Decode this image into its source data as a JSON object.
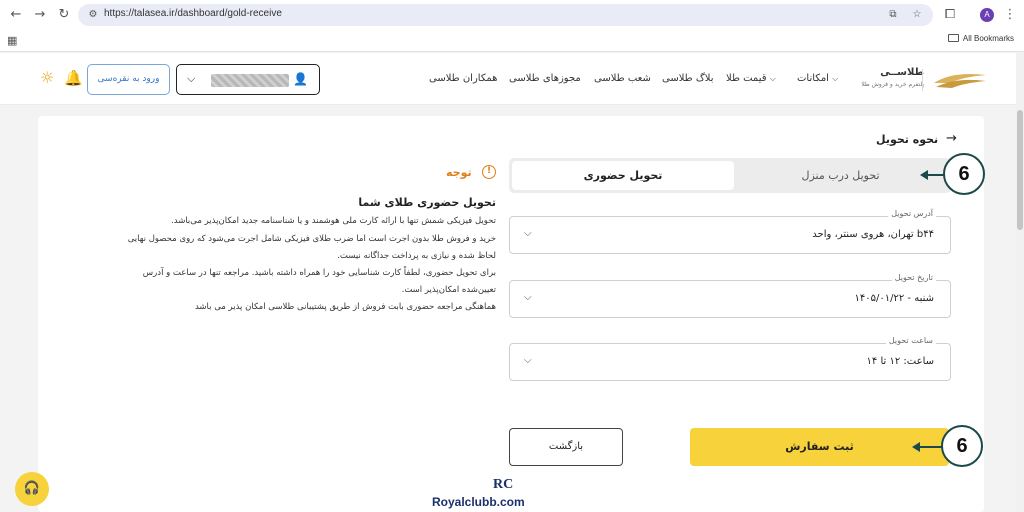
{
  "browser": {
    "url": "https://talasea.ir/dashboard/gold-receive",
    "profile_initial": "A",
    "bookmarks_label": "All Bookmarks"
  },
  "header": {
    "logo_title": "طلاســی",
    "logo_subtitle": "پلتفرم خرید و فروش طلا",
    "nav": [
      "امکانات",
      "قیمت طلا",
      "بلاگ طلاسی",
      "شعب طلاسی",
      "مجوزهای طلاسی",
      "همکاران طلاسی"
    ],
    "silver_login": "ورود به نقره‌سی"
  },
  "page": {
    "title": "نحوه تحویل",
    "tabs": [
      "تحویل حضوری",
      "تحویل درب منزل"
    ],
    "active_tab": "تحویل حضوری",
    "fields": [
      {
        "label": "آدرس تحویل",
        "value": "تهران، هروی سنتر، واحد b۴۴"
      },
      {
        "label": "تاریخ تحویل",
        "value": "۱۴۰۵/۰۱/۲۲ - شنبه"
      },
      {
        "label": "ساعت تحویل",
        "value": "ساعت: ۱۲ تا ۱۴"
      }
    ],
    "submit_label": "ثبت سفارش",
    "back_label": "بازگشت"
  },
  "notice": {
    "heading": "توجه",
    "title": "تحویل حضوری طلای شما",
    "lines": [
      "تحویل فیزیکی شمش تنها با ارائه کارت ملی هوشمند و یا شناسنامه جدید امکان‌پذیر می‌باشد.",
      "خرید و فروش طلا بدون اجرت است اما ضرب طلای فیزیکی شامل اجرت می‌شود که روی محصول نهایی",
      "لحاظ شده و نیازی به پرداخت جداگانه نیست.",
      "برای تحویل حضوری، لطفاً کارت شناسایی خود را همراه داشته باشید. مراجعه تنها در ساعت و آدرس",
      "تعیین‌شده امکان‌پذیر است.",
      "هماهنگی مراجعه حضوری بابت فروش از طریق پشتیبانی طلاسی امکان پذیر می باشد"
    ]
  },
  "annotations": {
    "tab_badge": "6",
    "submit_badge": "6"
  },
  "watermark": {
    "mark": "RC",
    "text": "Royalclubb.com"
  },
  "colors": {
    "accent_yellow": "#f7d23a",
    "notice_orange": "#e07d16",
    "badge_border": "#1c4a4a"
  }
}
